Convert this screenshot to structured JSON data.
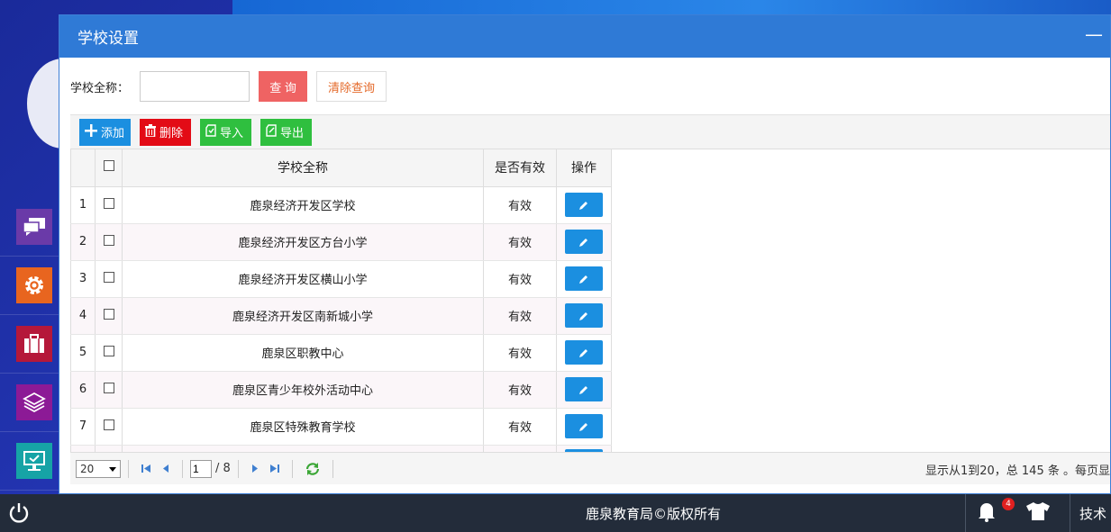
{
  "window": {
    "title": "学校设置",
    "minimize_glyph": "—"
  },
  "search": {
    "label": "学校全称：",
    "value": "",
    "placeholder": "",
    "query_label": "查 询",
    "clear_label": "清除查询"
  },
  "toolbar": {
    "add": "添加",
    "delete": "删除",
    "import": "导入",
    "export": "导出"
  },
  "table": {
    "columns": {
      "name": "学校全称",
      "valid": "是否有效",
      "op": "操作"
    },
    "rows": [
      {
        "num": "1",
        "name": "鹿泉经济开发区学校",
        "valid": "有效"
      },
      {
        "num": "2",
        "name": "鹿泉经济开发区方台小学",
        "valid": "有效"
      },
      {
        "num": "3",
        "name": "鹿泉经济开发区横山小学",
        "valid": "有效"
      },
      {
        "num": "4",
        "name": "鹿泉经济开发区南新城小学",
        "valid": "有效"
      },
      {
        "num": "5",
        "name": "鹿泉区职教中心",
        "valid": "有效"
      },
      {
        "num": "6",
        "name": "鹿泉区青少年校外活动中心",
        "valid": "有效"
      },
      {
        "num": "7",
        "name": "鹿泉区特殊教育学校",
        "valid": "有效"
      }
    ]
  },
  "pager": {
    "page_size": "20",
    "current_page": "1",
    "total_pages": "/ 8",
    "info": "显示从1到20，总 145 条 。每页显"
  },
  "taskbar": {
    "copyright": "鹿泉教育局©版权所有",
    "notification_count": "4",
    "tech_label": "技术"
  },
  "colors": {
    "title_bar": "#2f7ad6",
    "add": "#1b8fe0",
    "delete": "#e30b16",
    "import_export": "#2fbf3f",
    "query": "#ef6363"
  }
}
